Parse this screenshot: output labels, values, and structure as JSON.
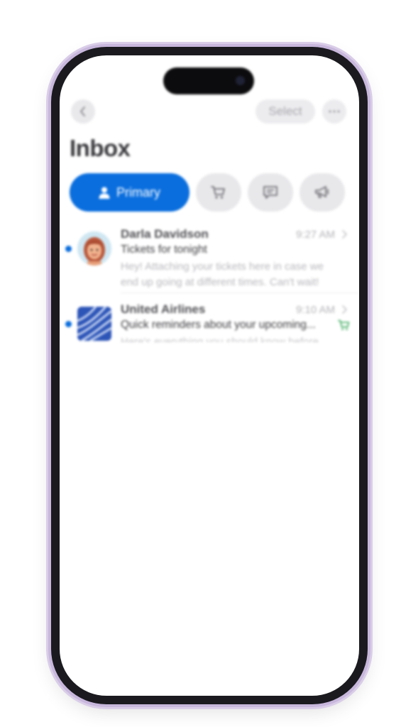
{
  "nav": {
    "back_icon": "chevron-left-icon",
    "select_label": "Select",
    "more_icon": "ellipsis-icon"
  },
  "page": {
    "title": "Inbox"
  },
  "tabs": {
    "primary": {
      "label": "Primary",
      "icon": "person-icon"
    },
    "transactions": {
      "icon": "cart-icon"
    },
    "updates": {
      "icon": "message-icon"
    },
    "promotions": {
      "icon": "megaphone-icon"
    }
  },
  "messages": [
    {
      "sender": "Darla Davidson",
      "time": "9:27 AM",
      "subject": "Tickets for tonight",
      "preview": "Hey! Attaching your tickets here in case we end up going at different times. Can't wait!",
      "unread": true
    },
    {
      "sender": "United Airlines",
      "time": "9:10 AM",
      "subject": "Quick reminders about your upcoming...",
      "preview": "Here's everything you should know before your flight.",
      "unread": true,
      "category_icon": "cart-icon"
    }
  ],
  "colors": {
    "accent": "#0a6ede",
    "frame": "#1a1a1f",
    "frame_tint": "#c8b7dc",
    "tab_bg": "#e8e8eb"
  }
}
